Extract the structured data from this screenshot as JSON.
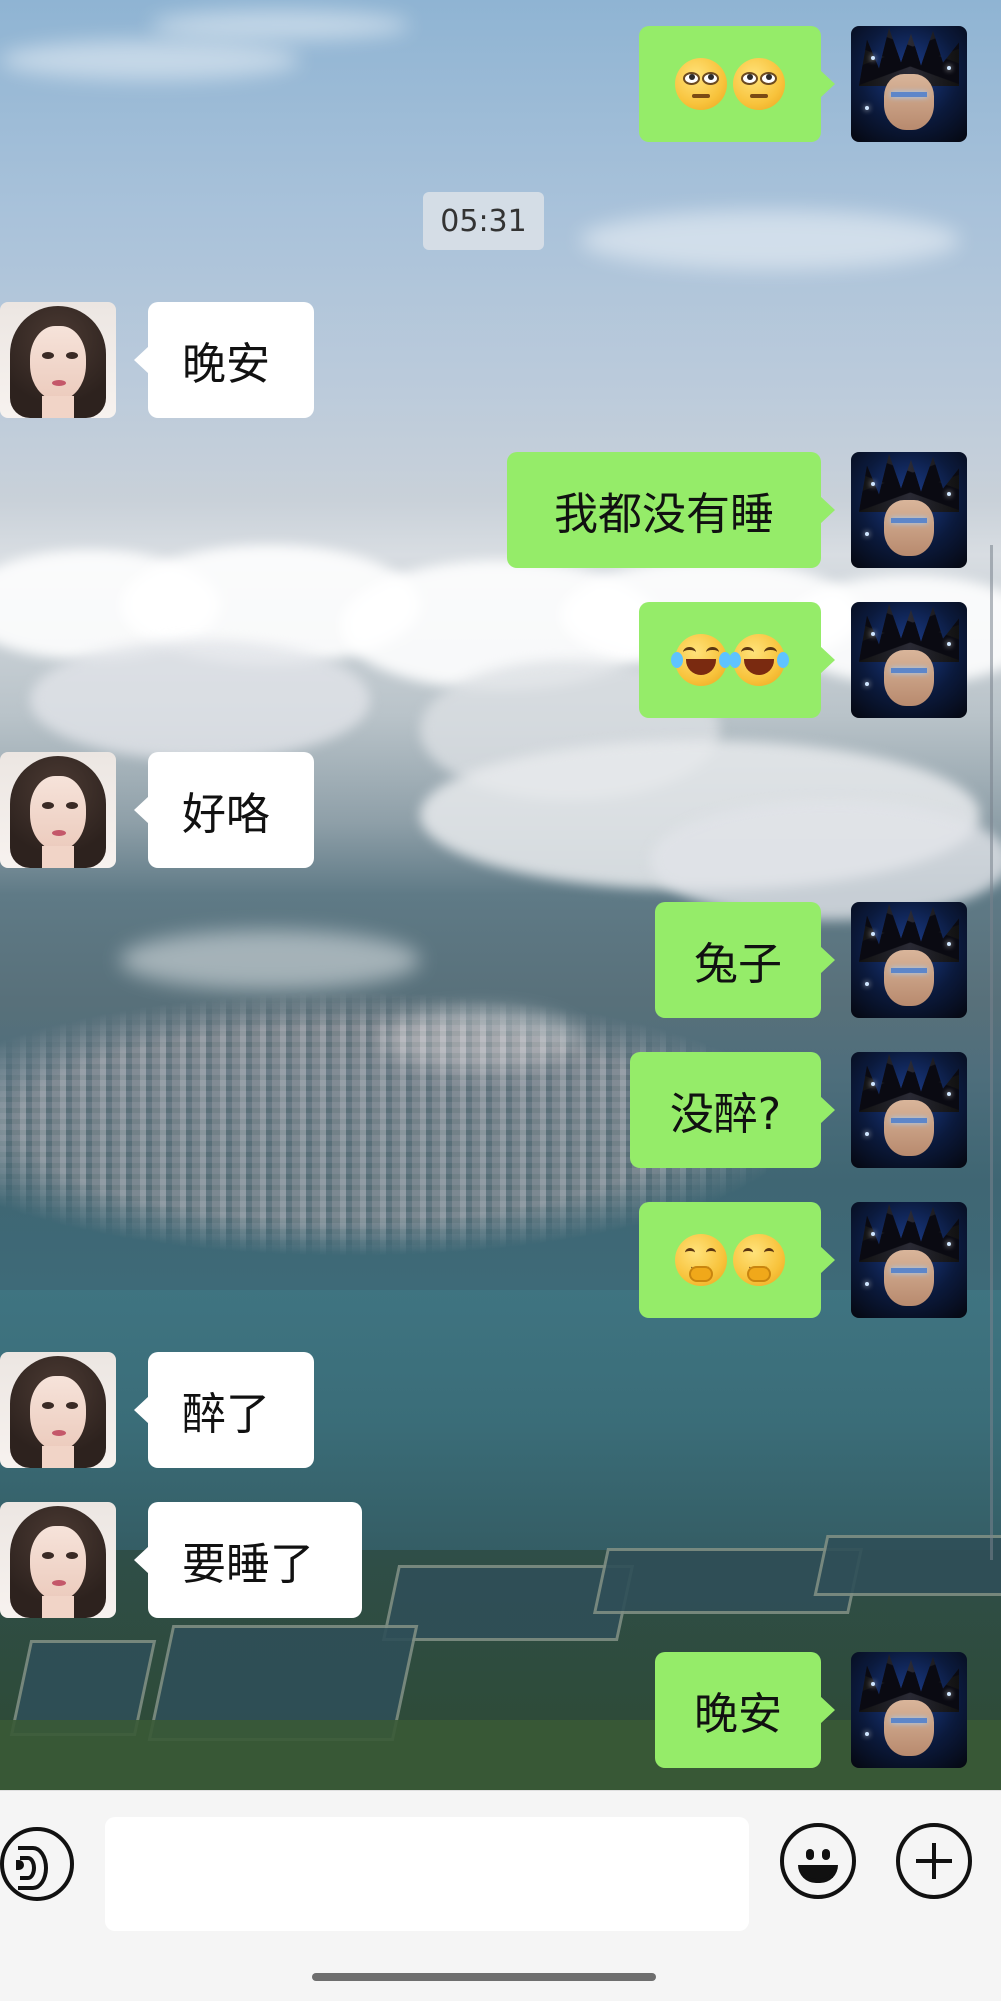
{
  "timestamp": "05:31",
  "messages": [
    {
      "side": "out",
      "kind": "emoji",
      "emoji": [
        "face-with-rolling-eyes",
        "face-with-rolling-eyes"
      ]
    },
    {
      "side": "in",
      "kind": "text",
      "text": "晚安"
    },
    {
      "side": "out",
      "kind": "text",
      "text": "我都没有睡"
    },
    {
      "side": "out",
      "kind": "emoji",
      "emoji": [
        "face-with-tears-of-joy",
        "face-with-tears-of-joy"
      ]
    },
    {
      "side": "in",
      "kind": "text",
      "text": "好咯"
    },
    {
      "side": "out",
      "kind": "text",
      "text": "兔子"
    },
    {
      "side": "out",
      "kind": "text",
      "text": "没醉?"
    },
    {
      "side": "out",
      "kind": "emoji",
      "emoji": [
        "face-with-hand-over-mouth",
        "face-with-hand-over-mouth"
      ]
    },
    {
      "side": "in",
      "kind": "text",
      "text": "醉了"
    },
    {
      "side": "in",
      "kind": "text",
      "text": "要睡了"
    },
    {
      "side": "out",
      "kind": "text",
      "text": "晚安"
    }
  ],
  "input": {
    "value": "",
    "placeholder": ""
  },
  "colors": {
    "outgoing_bubble": "#95ec69",
    "incoming_bubble": "#ffffff",
    "input_bar": "#f5f5f5"
  },
  "icons": {
    "voice": "voice-icon",
    "emoji": "emoji-icon",
    "plus": "plus-icon"
  }
}
